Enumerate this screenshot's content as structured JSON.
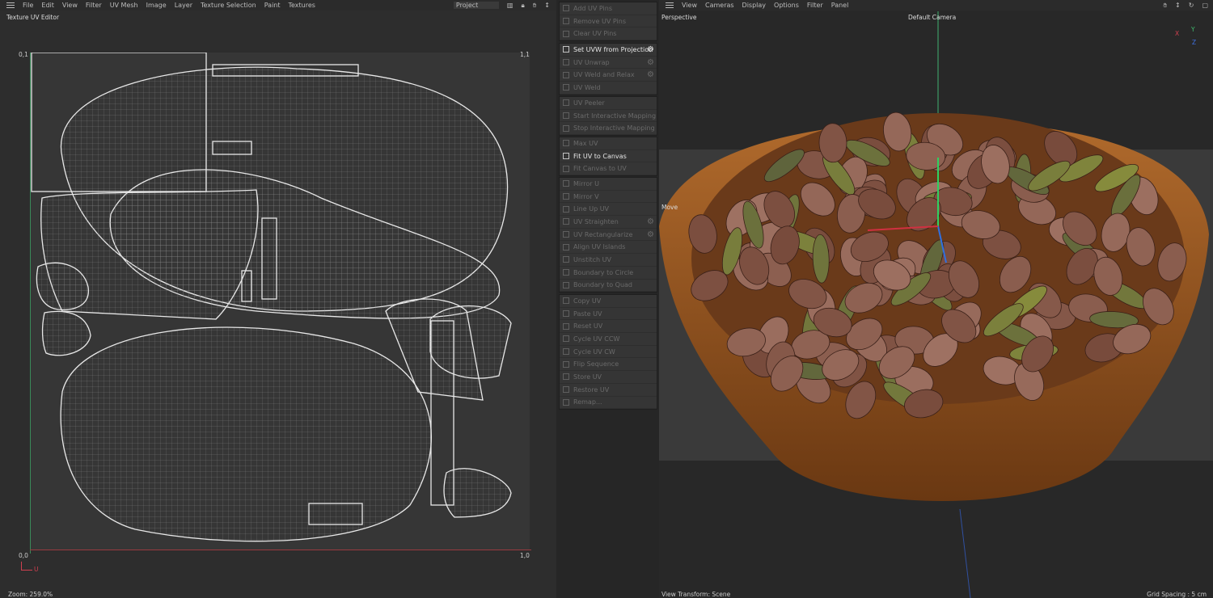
{
  "uv_editor": {
    "menu": [
      "File",
      "Edit",
      "View",
      "Filter",
      "UV Mesh",
      "Image",
      "Layer",
      "Texture Selection",
      "Paint",
      "Textures"
    ],
    "project_dropdown": "Project",
    "title": "Texture UV Editor",
    "corners": {
      "top_left": "0,1",
      "top_right": "1,1",
      "bottom_left": "0,0",
      "bottom_right": "1,0"
    },
    "axis_u": "U",
    "zoom": "Zoom: 259.0%"
  },
  "commands": {
    "groups": [
      [
        {
          "label": "Add UV Pins",
          "enabled": false
        },
        {
          "label": "Remove UV Pins",
          "enabled": false
        },
        {
          "label": "Clear UV Pins",
          "enabled": false
        }
      ],
      [
        {
          "label": "Set UVW from Projection",
          "enabled": true,
          "gear": true
        },
        {
          "label": "UV Unwrap",
          "enabled": false,
          "gear": true
        },
        {
          "label": "UV Weld and Relax",
          "enabled": false,
          "gear": true
        },
        {
          "label": "UV Weld",
          "enabled": false
        }
      ],
      [
        {
          "label": "UV Peeler",
          "enabled": false
        },
        {
          "label": "Start Interactive Mapping",
          "enabled": false
        },
        {
          "label": "Stop Interactive Mapping",
          "enabled": false
        }
      ],
      [
        {
          "label": "Max UV",
          "enabled": false
        },
        {
          "label": "Fit UV to Canvas",
          "enabled": true
        },
        {
          "label": "Fit Canvas to UV",
          "enabled": false
        }
      ],
      [
        {
          "label": "Mirror U",
          "enabled": false
        },
        {
          "label": "Mirror V",
          "enabled": false
        },
        {
          "label": "Line Up UV",
          "enabled": false
        },
        {
          "label": "UV Straighten",
          "enabled": false,
          "gear": true
        },
        {
          "label": "UV Rectangularize",
          "enabled": false,
          "gear": true
        },
        {
          "label": "Align UV Islands",
          "enabled": false
        },
        {
          "label": "Unstitch UV",
          "enabled": false
        },
        {
          "label": "Boundary to Circle",
          "enabled": false
        },
        {
          "label": "Boundary to Quad",
          "enabled": false
        }
      ],
      [
        {
          "label": "Copy UV",
          "enabled": false
        },
        {
          "label": "Paste UV",
          "enabled": false
        },
        {
          "label": "Reset UV",
          "enabled": false
        },
        {
          "label": "Cycle UV CCW",
          "enabled": false
        },
        {
          "label": "Cycle UV CW",
          "enabled": false
        },
        {
          "label": "Flip Sequence",
          "enabled": false
        },
        {
          "label": "Store UV",
          "enabled": false
        },
        {
          "label": "Restore UV",
          "enabled": false
        },
        {
          "label": "Remap...",
          "enabled": false
        }
      ]
    ]
  },
  "viewport": {
    "menu": [
      "View",
      "Cameras",
      "Display",
      "Options",
      "Filter",
      "Panel"
    ],
    "projection": "Perspective",
    "camera": "Default Camera",
    "tool": "Move",
    "axes": {
      "x": "X",
      "y": "Y",
      "z": "Z"
    },
    "view_transform": "View Transform: Scene",
    "grid_spacing": "Grid Spacing : 5 cm"
  },
  "colors": {
    "x_axis": "#d04050",
    "y_axis": "#40c070",
    "z_axis": "#4070e0",
    "bowl": "#9a5a25"
  }
}
